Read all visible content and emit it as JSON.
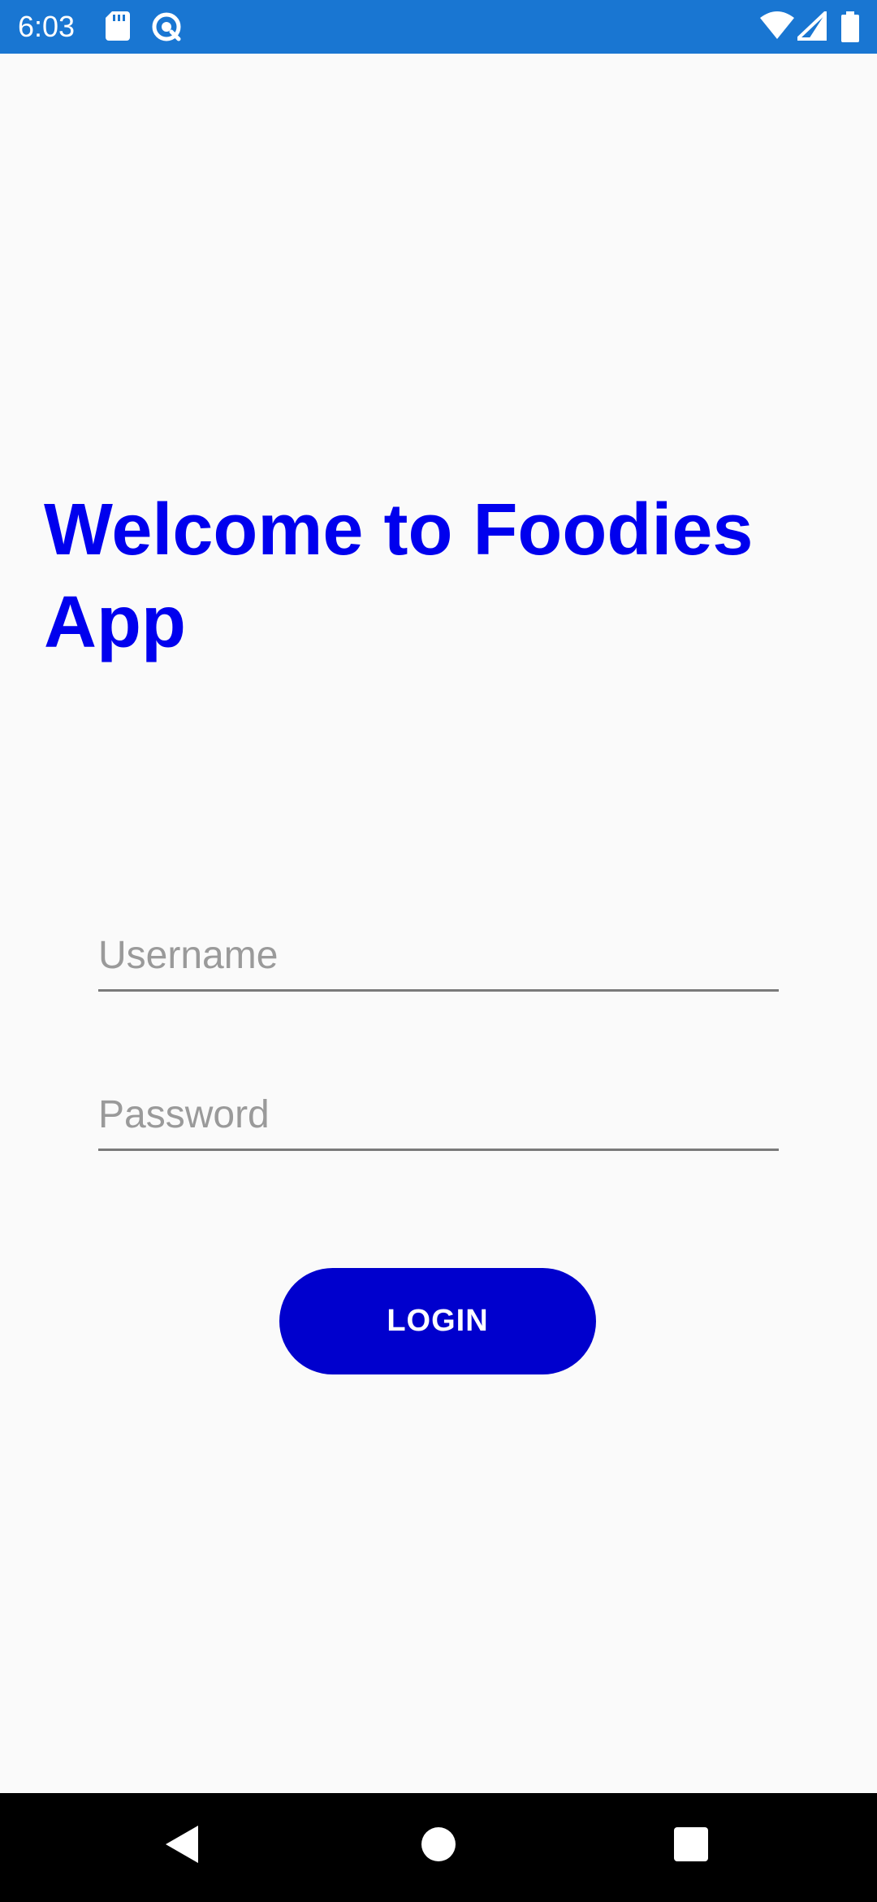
{
  "status_bar": {
    "time": "6:03",
    "background_color": "#1976d2",
    "icons": [
      "sd-card-icon",
      "data-saver-icon",
      "wifi-icon",
      "signal-icon",
      "battery-icon"
    ]
  },
  "welcome": {
    "title": "Welcome to Foodies App",
    "color": "#0000ee"
  },
  "login_form": {
    "username_placeholder": "Username",
    "username_value": "",
    "password_placeholder": "Password",
    "password_value": "",
    "login_label": "LOGIN",
    "button_color": "#0000cd"
  },
  "nav_bar": {
    "icons": [
      "back-icon",
      "home-icon",
      "recents-icon"
    ]
  }
}
